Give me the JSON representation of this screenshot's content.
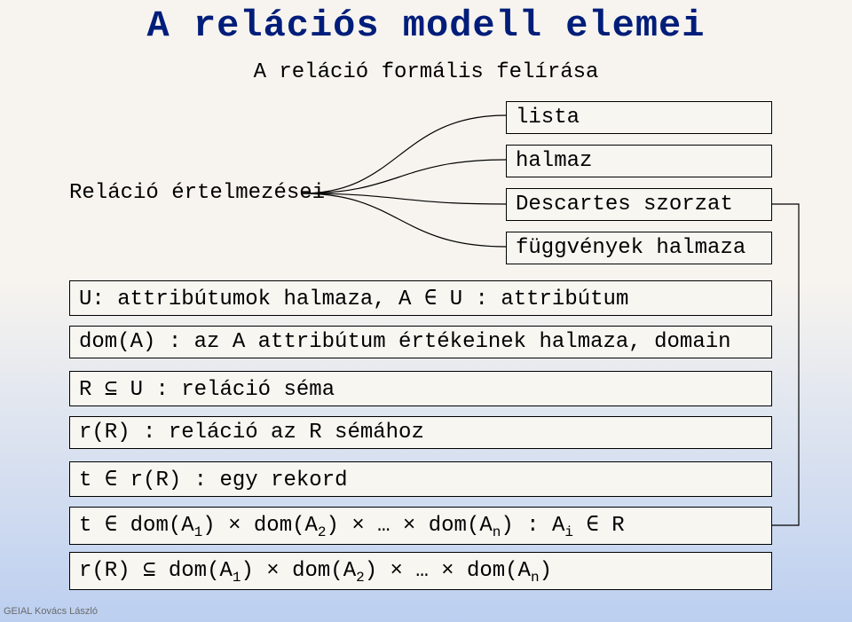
{
  "title": "A relációs modell elemei",
  "subtitle": "A reláció formális felírása",
  "rel_label": "Reláció értelmezései",
  "boxes": {
    "lista": "lista",
    "halmaz": "halmaz",
    "descartes": "Descartes szorzat",
    "fuggvenyek": "függvények halmaza",
    "u_attr": "U: attribútumok halmaza, A ∈ U : attribútum",
    "dom_a": "dom(A) : az A attribútum értékeinek halmaza, domain",
    "r_sema": "R ⊆ U : reláció séma",
    "r_r": "r(R) : reláció az R sémához",
    "t_rec": "t ∈ r(R) : egy rekord"
  },
  "t_dom": {
    "p1": "t ∈ dom(A",
    "s1": "1",
    "p2": ") × dom(A",
    "s2": "2",
    "p3": ") × … × dom(A",
    "s3": "n",
    "p4": ") : A",
    "s4": "i",
    "p5": " ∈ R"
  },
  "rr_dom": {
    "p1": "r(R) ⊆ dom(A",
    "s1": "1",
    "p2": ") × dom(A",
    "s2": "2",
    "p3": ") × … × dom(A",
    "s3": "n",
    "p4": ")"
  },
  "footer": "GEIAL Kovács László"
}
